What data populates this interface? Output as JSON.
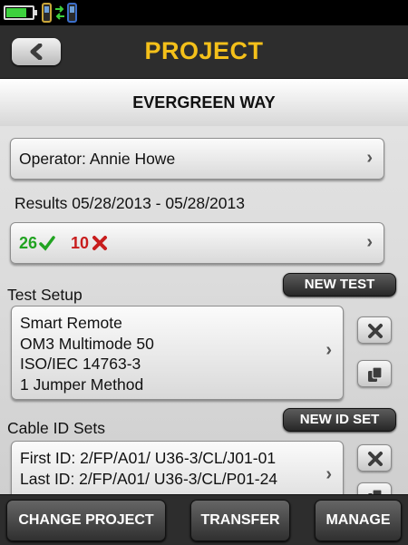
{
  "header": {
    "title": "PROJECT"
  },
  "project": {
    "name": "EVERGREEN WAY"
  },
  "operator": {
    "text": "Operator: Annie Howe"
  },
  "results": {
    "label": "Results 05/28/2013 - 05/28/2013",
    "pass_count": "26",
    "fail_count": "10"
  },
  "test_setup": {
    "label": "Test Setup",
    "new_button": "NEW TEST",
    "lines": [
      "Smart Remote",
      "OM3 Multimode 50",
      "ISO/IEC 14763-3",
      "1 Jumper Method"
    ]
  },
  "cable_id_sets": {
    "label": "Cable ID Sets",
    "new_button": "NEW ID SET",
    "first_id": "First ID: 2/FP/A01/ U36-3/CL/J01-01",
    "last_id": "Last ID: 2/FP/A01/ U36-3/CL/P01-24"
  },
  "bottom_bar": {
    "change_project": "CHANGE PROJECT",
    "transfer": "TRANSFER",
    "manage": "MANAGE"
  },
  "status": {
    "battery_level": 0.8
  },
  "colors": {
    "title": "#f4c01a",
    "pass": "#21a321",
    "fail": "#c81d1d",
    "battery": "#3dd13d"
  },
  "icons": {
    "back": "back-arrow-icon",
    "pass": "check-icon",
    "fail": "x-icon",
    "delete": "close-icon",
    "copy": "copy-icon",
    "chevron": "chevron-right-icon"
  }
}
